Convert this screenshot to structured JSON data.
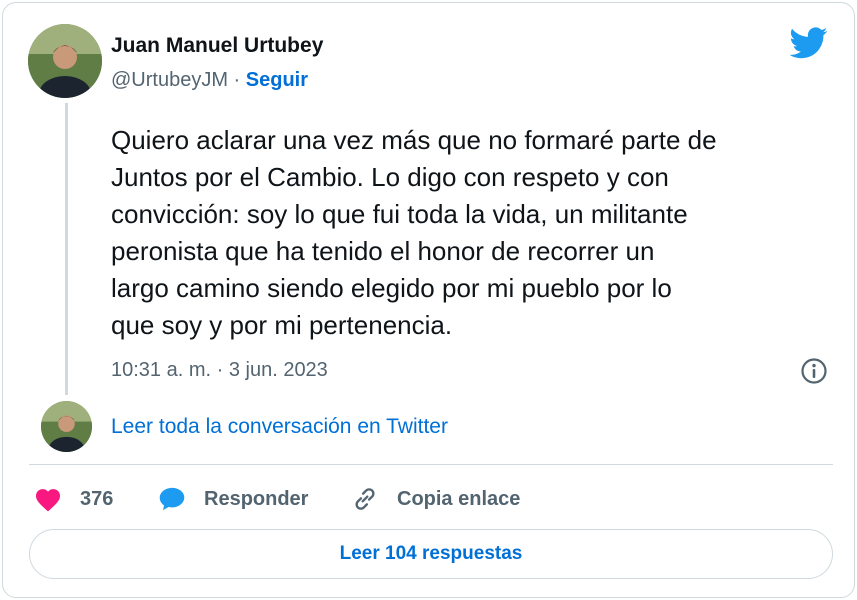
{
  "author": {
    "name": "Juan Manuel Urtubey",
    "handle": "@UrtubeyJM",
    "separator": " · ",
    "follow_label": "Seguir"
  },
  "tweet": {
    "text": "Quiero aclarar una vez más que no formaré parte de\nJuntos por el Cambio. Lo digo con respeto y con\nconvicción: soy lo que fui toda la vida, un militante\nperonista que ha tenido el honor de recorrer un\nlargo camino siendo elegido por mi pueblo por lo\nque soy y por mi pertenencia.",
    "timestamp": "10:31 a. m. · 3 jun. 2023"
  },
  "conversation_link": "Leer toda la conversación en Twitter",
  "actions": {
    "likes": "376",
    "reply_label": "Responder",
    "copy_label": "Copia enlace"
  },
  "read_replies_label": "Leer 104 respuestas",
  "icons": {
    "brand": "twitter-bird-icon",
    "info": "info-icon",
    "like": "heart-icon",
    "reply": "speech-bubble-icon",
    "copy": "link-icon"
  },
  "colors": {
    "accent": "#1d9bf0",
    "link": "#006fd6",
    "like": "#f91880",
    "muted": "#536471",
    "border": "#cfd9de"
  }
}
